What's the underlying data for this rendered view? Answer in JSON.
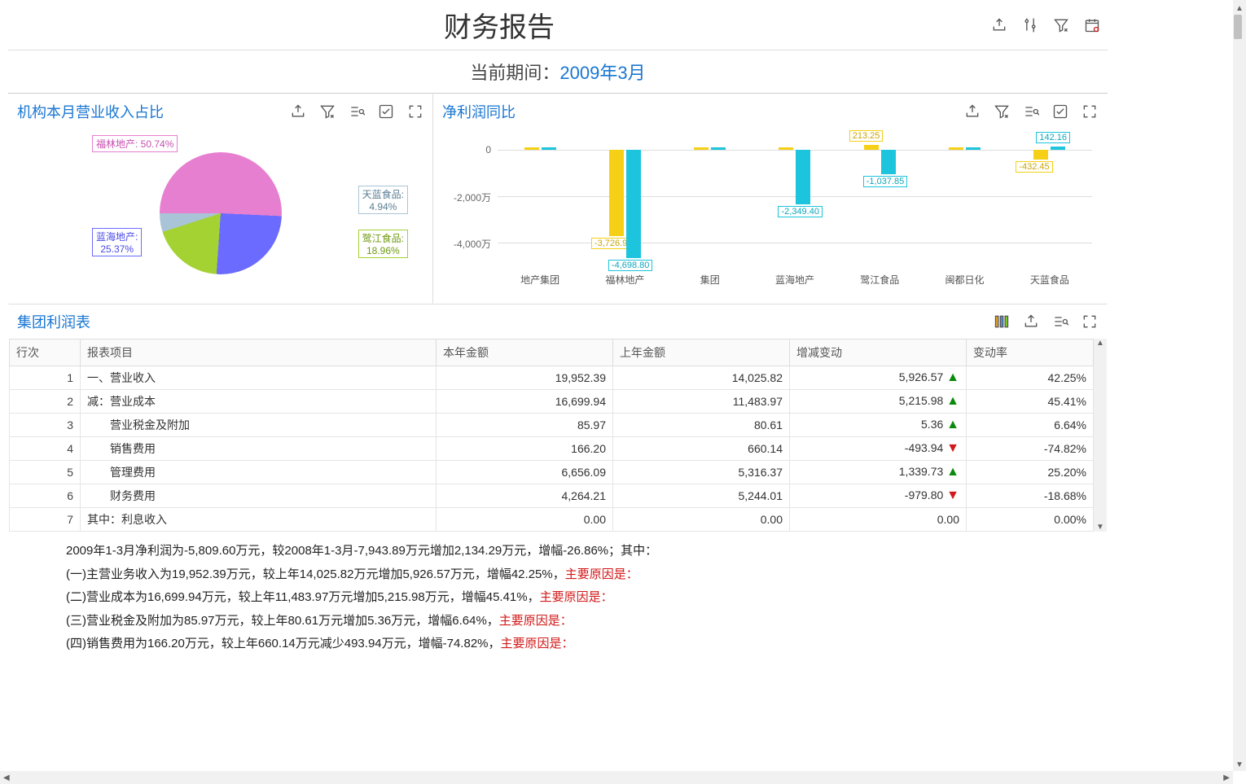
{
  "header": {
    "title": "财务报告"
  },
  "period": {
    "label": "当前期间：",
    "value": "2009年3月"
  },
  "panel_pie": {
    "title": "机构本月营业收入占比"
  },
  "panel_bar": {
    "title": "净利润同比"
  },
  "panel_tbl": {
    "title": "集团利润表"
  },
  "table": {
    "columns": {
      "c0": "行次",
      "c1": "报表项目",
      "c2": "本年金额",
      "c3": "上年金额",
      "c4": "增减变动",
      "c5": "变动率"
    },
    "rows": [
      {
        "n": "1",
        "item": "一、营业收入",
        "cur": "19,952.39",
        "prev": "14,025.82",
        "chg": "5,926.57",
        "dir": "up",
        "rate": "42.25%"
      },
      {
        "n": "2",
        "item": "减：营业成本",
        "cur": "16,699.94",
        "prev": "11,483.97",
        "chg": "5,215.98",
        "dir": "up",
        "rate": "45.41%"
      },
      {
        "n": "3",
        "item": "　　营业税金及附加",
        "cur": "85.97",
        "prev": "80.61",
        "chg": "5.36",
        "dir": "up",
        "rate": "6.64%"
      },
      {
        "n": "4",
        "item": "　　销售费用",
        "cur": "166.20",
        "prev": "660.14",
        "chg": "-493.94",
        "dir": "down",
        "rate": "-74.82%"
      },
      {
        "n": "5",
        "item": "　　管理费用",
        "cur": "6,656.09",
        "prev": "5,316.37",
        "chg": "1,339.73",
        "dir": "up",
        "rate": "25.20%"
      },
      {
        "n": "6",
        "item": "　　财务费用",
        "cur": "4,264.21",
        "prev": "5,244.01",
        "chg": "-979.80",
        "dir": "down",
        "rate": "-18.68%"
      },
      {
        "n": "7",
        "item": "其中：利息收入",
        "cur": "0.00",
        "prev": "0.00",
        "chg": "0.00",
        "dir": "",
        "rate": "0.00%"
      }
    ]
  },
  "notes": {
    "l0": "2009年1-3月净利润为-5,809.60万元，较2008年1-3月-7,943.89万元增加2,134.29万元，增幅-26.86%；其中：",
    "l1a": "(一)主营业务收入为19,952.39万元，较上年14,025.82万元增加5,926.57万元，增幅42.25%，",
    "l1b": "主要原因是：",
    "l2a": "(二)营业成本为16,699.94万元，较上年11,483.97万元增加5,215.98万元，增幅45.41%，",
    "l2b": "主要原因是：",
    "l3a": "(三)营业税金及附加为85.97万元，较上年80.61万元增加5.36万元，增幅6.64%，",
    "l3b": "主要原因是：",
    "l4a": "(四)销售费用为166.20万元，较上年660.14万元减少493.94万元，增幅-74.82%，",
    "l4b": "主要原因是："
  },
  "chart_data": [
    {
      "type": "pie",
      "title": "机构本月营业收入占比",
      "slices": [
        {
          "name": "福林地产",
          "value": 50.74,
          "label": "福林地产: 50.74%",
          "color": "#e77fd0"
        },
        {
          "name": "蓝海地产",
          "value": 25.37,
          "label": "蓝海地产: 25.37%",
          "color": "#6b6bff"
        },
        {
          "name": "鹭江食品",
          "value": 18.96,
          "label": "鹭江食品: 18.96%",
          "color": "#a4d233"
        },
        {
          "name": "天蓝食品",
          "value": 4.94,
          "label": "天蓝食品: 4.94%",
          "color": "#a9c4d6"
        }
      ]
    },
    {
      "type": "bar",
      "title": "净利润同比",
      "ylabel": "",
      "ylim": [
        -5000,
        500
      ],
      "yticks": [
        0,
        -2000,
        -4000
      ],
      "ytick_labels": [
        "0",
        "-2,000万",
        "-4,000万"
      ],
      "categories": [
        "地产集团",
        "福林地产",
        "集团",
        "蓝海地产",
        "鹭江食品",
        "闽都日化",
        "天蓝食品"
      ],
      "series": [
        {
          "name": "series_a",
          "color": "#f5d016",
          "values": [
            null,
            -3726.93,
            null,
            null,
            213.25,
            null,
            -432.45
          ]
        },
        {
          "name": "series_b",
          "color": "#1cc5dd",
          "values": [
            null,
            -4698.8,
            null,
            -2349.4,
            -1037.85,
            null,
            142.16
          ]
        }
      ]
    }
  ]
}
